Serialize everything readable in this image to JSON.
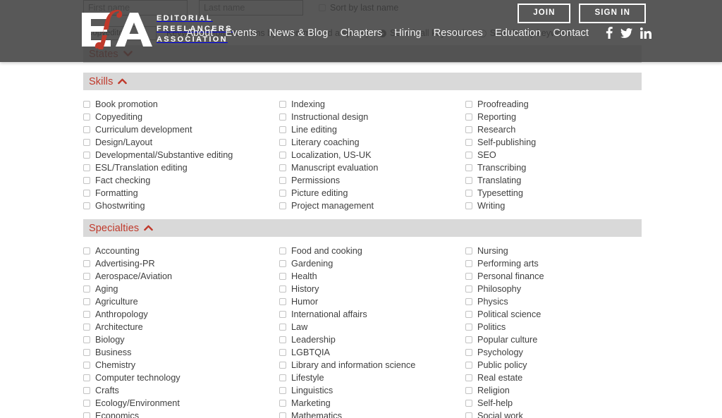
{
  "header": {
    "logo": {
      "mark_text": "EfA",
      "line1": "EDITORIAL",
      "line2": "FREELANCERS",
      "line3": "ASSOCIATION",
      "red_hex": "#c0392b",
      "bg_hex": "#3d3d3d"
    },
    "join_label": "JOIN",
    "signin_label": "SIGN IN",
    "nav": [
      {
        "label": "About"
      },
      {
        "label": "Events"
      },
      {
        "label": "News & Blog"
      },
      {
        "label": "Chapters"
      },
      {
        "label": "Hiring"
      },
      {
        "label": "Resources"
      },
      {
        "label": "Education"
      },
      {
        "label": "Contact"
      }
    ],
    "social": [
      {
        "name": "facebook-icon"
      },
      {
        "name": "twitter-icon"
      },
      {
        "name": "linkedin-icon"
      }
    ]
  },
  "search_form": {
    "first_name": {
      "placeholder": "First name",
      "value": ""
    },
    "last_name": {
      "placeholder": "Last name",
      "value": ""
    },
    "sort_by_last_name_label": "Sort by last name",
    "sort_by_last_name_checked": false,
    "job_title": {
      "value": "Copyeditor"
    },
    "keyword_hint": "Keyword (separate terms by a comma and a space)",
    "search_mode": {
      "all_label": "Search all keywords",
      "any_label": "Search any keywords",
      "selected": "all"
    }
  },
  "sections": [
    {
      "id": "states",
      "title": "States",
      "expanded": false,
      "chevron": "chevron-down-icon"
    },
    {
      "id": "skills",
      "title": "Skills",
      "expanded": true,
      "chevron": "chevron-up-icon",
      "columns": [
        [
          "Book promotion",
          "Copyediting",
          "Curriculum development",
          "Design/Layout",
          "Developmental/Substantive editing",
          "ESL/Translation editing",
          "Fact checking",
          "Formatting",
          "Ghostwriting"
        ],
        [
          "Indexing",
          "Instructional design",
          "Line editing",
          "Literary coaching",
          "Localization, US-UK",
          "Manuscript evaluation",
          "Permissions",
          "Picture editing",
          "Project management"
        ],
        [
          "Proofreading",
          "Reporting",
          "Research",
          "Self-publishing",
          "SEO",
          "Transcribing",
          "Translating",
          "Typesetting",
          "Writing"
        ]
      ]
    },
    {
      "id": "specialties",
      "title": "Specialties",
      "expanded": true,
      "chevron": "chevron-up-icon",
      "columns": [
        [
          "Accounting",
          "Advertising-PR",
          "Aerospace/Aviation",
          "Aging",
          "Agriculture",
          "Anthropology",
          "Architecture",
          "Biology",
          "Business",
          "Chemistry",
          "Computer technology",
          "Crafts",
          "Ecology/Environment",
          "Economics"
        ],
        [
          "Food and cooking",
          "Gardening",
          "Health",
          "History",
          "Humor",
          "International affairs",
          "Law",
          "Leadership",
          "LGBTQIA",
          "Library and information science",
          "Lifestyle",
          "Linguistics",
          "Marketing",
          "Mathematics"
        ],
        [
          "Nursing",
          "Performing arts",
          "Personal finance",
          "Philosophy",
          "Physics",
          "Political science",
          "Politics",
          "Popular culture",
          "Psychology",
          "Public policy",
          "Real estate",
          "Religion",
          "Self-help",
          "Social work"
        ]
      ]
    }
  ],
  "colors": {
    "accent_red": "#c0392b",
    "section_bar_gray": "#d9d9d9",
    "header_dark": "#3d3d3d",
    "text_gray": "#3f3f3f"
  }
}
